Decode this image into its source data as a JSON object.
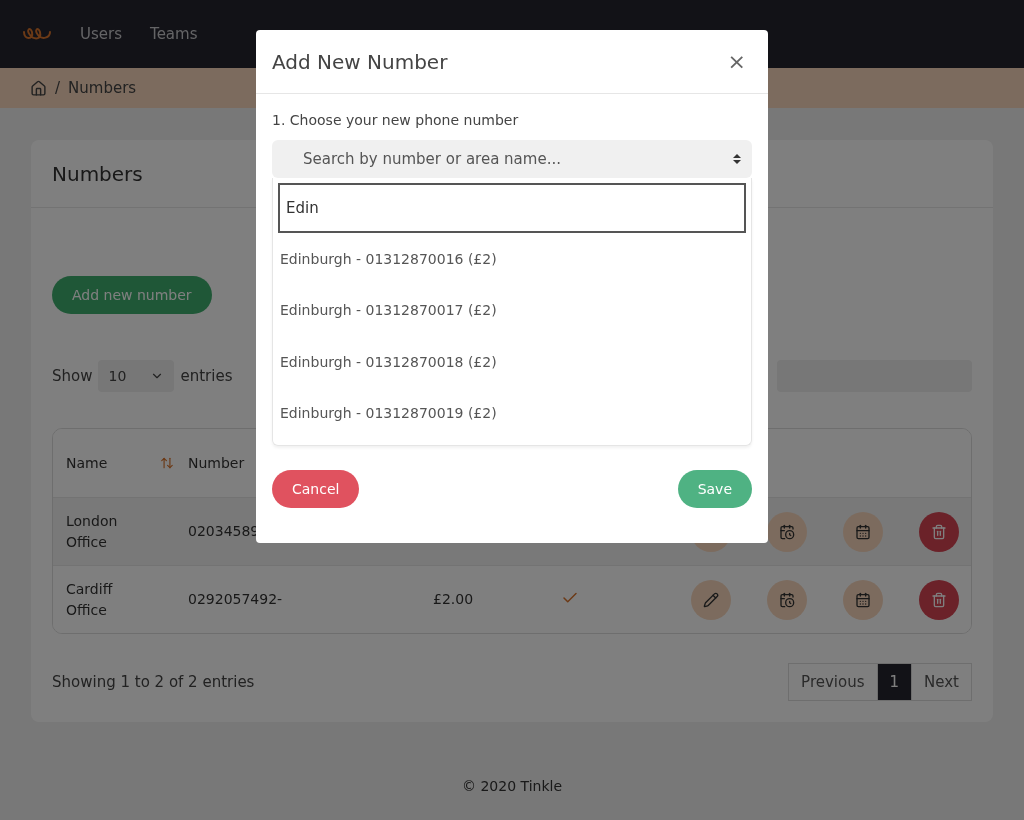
{
  "navbar": {
    "items": [
      {
        "label": "Users"
      },
      {
        "label": "Teams"
      }
    ]
  },
  "breadcrumb": {
    "separator": "/",
    "current": "Numbers"
  },
  "card": {
    "title": "Numbers",
    "add_button": "Add new number",
    "show_label": "Show",
    "page_length": "10",
    "entries_label": "entries",
    "table": {
      "columns": [
        "Name",
        "Number"
      ],
      "rows": [
        {
          "name": "London Office",
          "number": "02034589"
        },
        {
          "name": "Cardiff Office",
          "number": "0292057492-",
          "price": "£2.00",
          "active": true
        }
      ]
    },
    "info": "Showing 1 to 2 of 2 entries",
    "pagination": [
      {
        "label": "Previous",
        "selected": false
      },
      {
        "label": "1",
        "selected": true
      },
      {
        "label": "Next",
        "selected": false
      }
    ]
  },
  "footer": "© 2020 Tinkle",
  "modal": {
    "title": "Add New Number",
    "close": "×",
    "step_label": "1. Choose your new phone number",
    "select_placeholder": "Search by number or area name...",
    "search_value": "Edin",
    "options": [
      "Edinburgh - 01312870016 (£2)",
      "Edinburgh - 01312870017 (£2)",
      "Edinburgh - 01312870018 (£2)",
      "Edinburgh - 01312870019 (£2)"
    ],
    "cancel": "Cancel",
    "save": "Save"
  }
}
